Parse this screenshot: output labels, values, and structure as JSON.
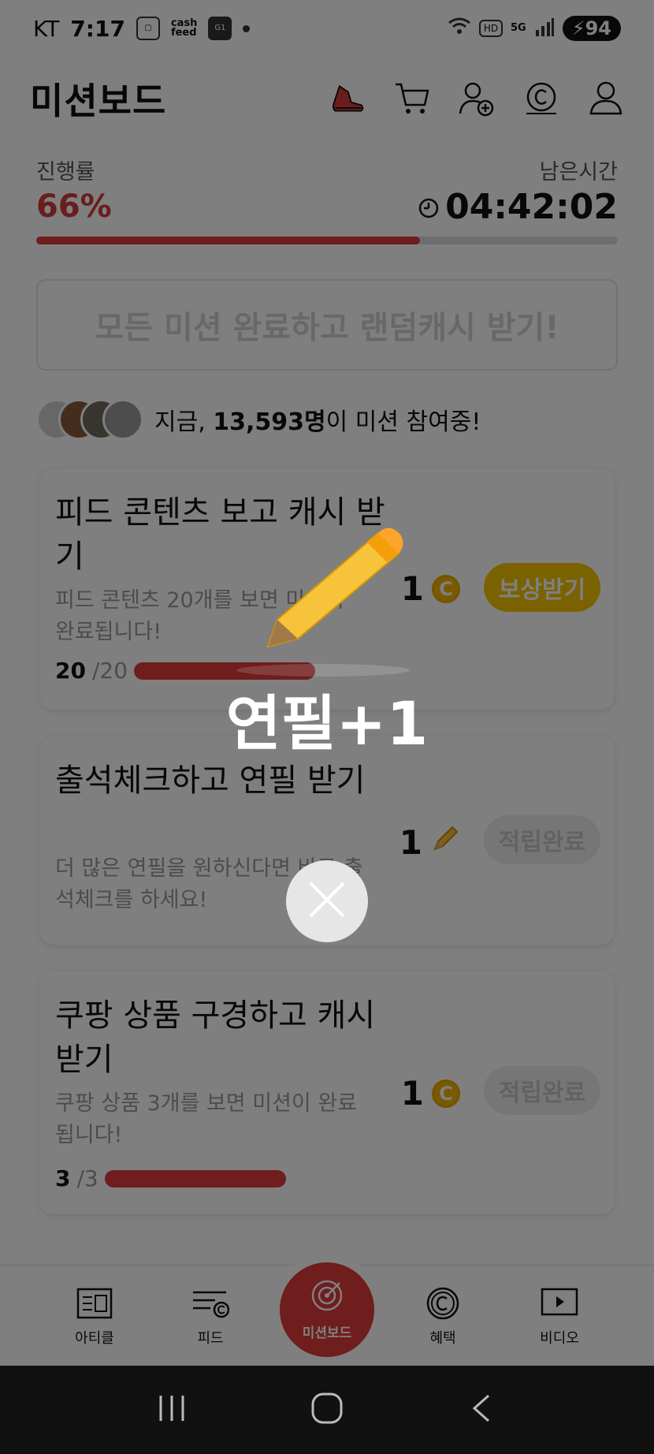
{
  "status_bar": {
    "carrier": "KT",
    "time": "7:17",
    "cash_label": "cash\nfeed",
    "badge": "G1",
    "network": "5G",
    "hd": "HD",
    "battery": "94"
  },
  "header": {
    "title": "미션보드"
  },
  "progress": {
    "label": "진행률",
    "value": "66%",
    "fraction": 0.66,
    "remain_label": "남은시간",
    "remain_value": "04:42:02"
  },
  "banner": {
    "text": "모든 미션 완료하고 랜덤캐시 받기!"
  },
  "participants": {
    "prefix": "지금, ",
    "count": "13,593명",
    "suffix": "이 미션 참여중!"
  },
  "missions": [
    {
      "title": "피드 콘텐츠 보고 캐시 받기",
      "desc": "피드 콘텐츠 20개를 보면 미션이 완료됩니다!",
      "done": "20",
      "total": "/20",
      "reward": "1",
      "reward_type": "coin-icon",
      "button": "보상받기",
      "fraction": 1.0
    },
    {
      "title": "출석체크하고 연필 받기",
      "desc": "더 많은 연필을 원하신다면 바로 출석체크를 하세요!",
      "reward": "1",
      "reward_type": "pencil-icon",
      "button": "적립완료"
    },
    {
      "title": "쿠팡 상품 구경하고 캐시받기",
      "desc": "쿠팡 상품 3개를 보면 미션이 완료됩니다!",
      "done": "3",
      "total": "/3",
      "reward": "1",
      "reward_type": "coin-icon",
      "button": "적립완료",
      "fraction": 1.0
    }
  ],
  "popup": {
    "text": "연필+1"
  },
  "nav": {
    "article": "아티클",
    "feed": "피드",
    "missionboard": "미션보드",
    "benefit": "혜택",
    "video": "비디오"
  },
  "colors": {
    "accent": "#e03b3b",
    "coin": "#f3b400",
    "overlay": "rgba(0,0,0,0.5)"
  }
}
